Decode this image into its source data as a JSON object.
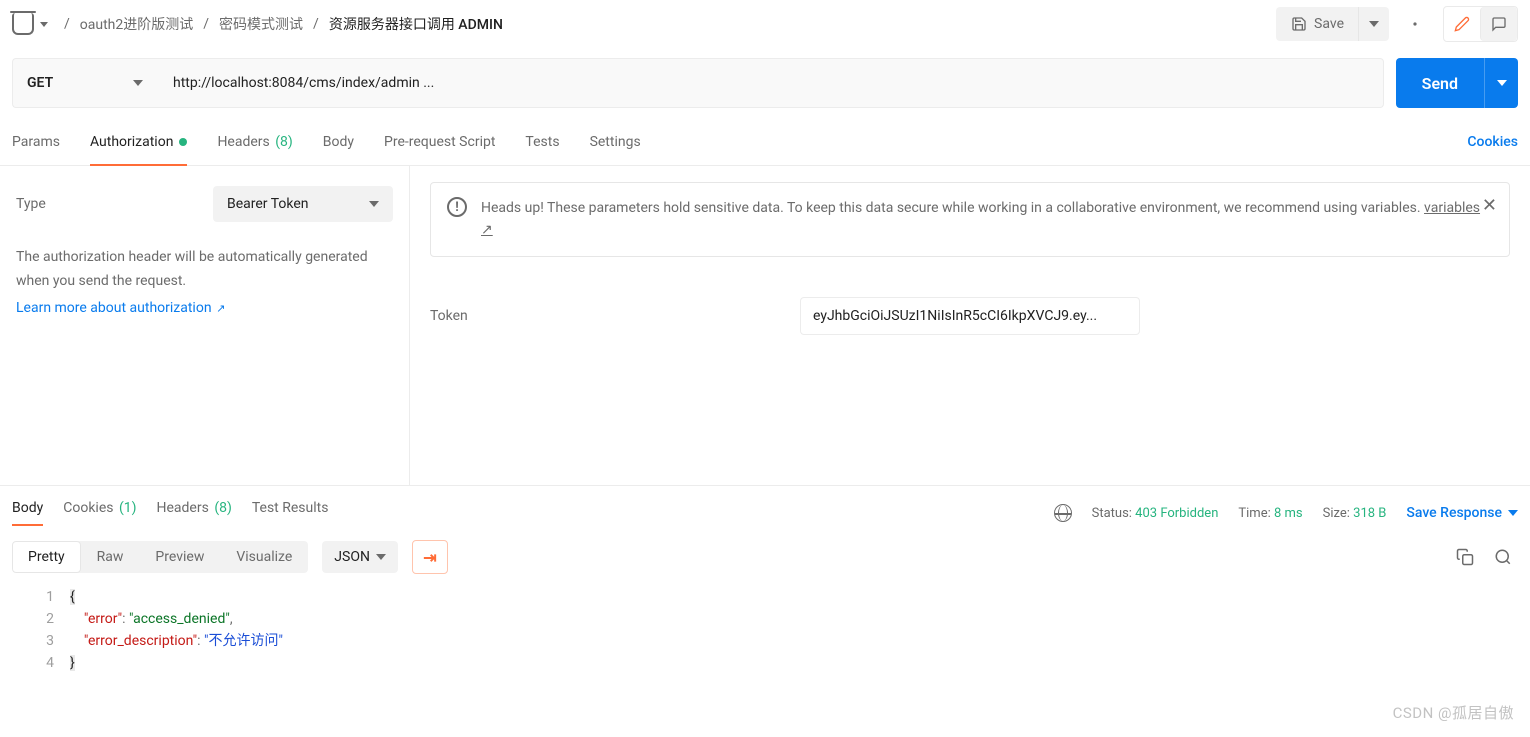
{
  "breadcrumb": {
    "items": [
      "oauth2进阶版测试",
      "密码模式测试",
      "资源服务器接口调用 ADMIN"
    ]
  },
  "toolbar": {
    "save": "Save"
  },
  "request": {
    "method": "GET",
    "url": "http://localhost:8084/cms/index/admin ...",
    "send": "Send"
  },
  "req_tabs": {
    "params": "Params",
    "auth": "Authorization",
    "headers": "Headers",
    "headers_count": "(8)",
    "body": "Body",
    "prereq": "Pre-request Script",
    "tests": "Tests",
    "settings": "Settings",
    "cookies": "Cookies"
  },
  "auth": {
    "type_label": "Type",
    "type_value": "Bearer Token",
    "desc": "The authorization header will be automatically generated when you send the request.",
    "learn": "Learn more about authorization",
    "alert": "Heads up! These parameters hold sensitive data. To keep this data secure while working in a collaborative environment, we recommend using variables.",
    "alert_link": "variables",
    "token_label": "Token",
    "token_value": "eyJhbGciOiJSUzI1NiIsInR5cCI6IkpXVCJ9.ey..."
  },
  "resp_tabs": {
    "body": "Body",
    "cookies": "Cookies",
    "cookies_count": "(1)",
    "headers": "Headers",
    "headers_count": "(8)",
    "tests": "Test Results"
  },
  "resp_meta": {
    "status_label": "Status:",
    "status_value": "403 Forbidden",
    "time_label": "Time:",
    "time_value": "8 ms",
    "size_label": "Size:",
    "size_value": "318 B",
    "save": "Save Response"
  },
  "body_tb": {
    "pretty": "Pretty",
    "raw": "Raw",
    "preview": "Preview",
    "visualize": "Visualize",
    "lang": "JSON"
  },
  "response_body": {
    "error_key": "\"error\"",
    "error_val": "\"access_denied\"",
    "desc_key": "\"error_description\"",
    "desc_val": "\"不允许访问\""
  },
  "watermark": "CSDN @孤居自傲"
}
